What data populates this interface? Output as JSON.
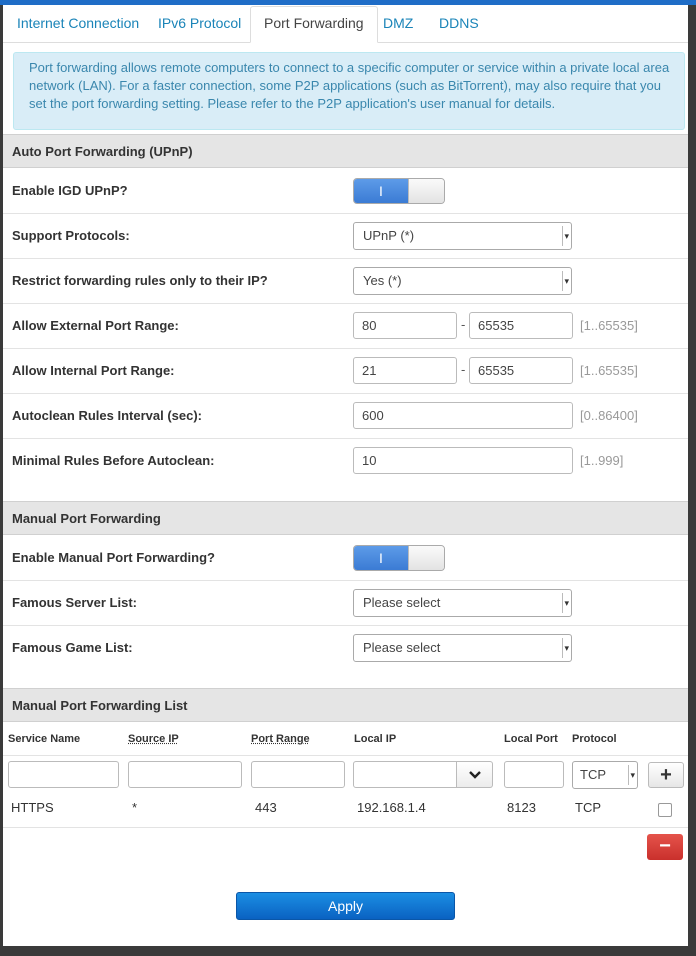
{
  "tabs": [
    {
      "label": "Internet Connection"
    },
    {
      "label": "IPv6 Protocol"
    },
    {
      "label": "Port Forwarding"
    },
    {
      "label": "DMZ"
    },
    {
      "label": "DDNS"
    }
  ],
  "info_text": "Port forwarding allows remote computers to connect to a specific computer or service within a private local area network (LAN). For a faster connection, some P2P applications (such as BitTorrent), may also require that you set the port forwarding setting. Please refer to the P2P application's user manual for details.",
  "upnp": {
    "title": "Auto Port Forwarding (UPnP)",
    "enable_label": "Enable IGD UPnP?",
    "enable_toggle_text": "I",
    "enabled": true,
    "protocols_label": "Support Protocols:",
    "protocols_value": "UPnP (*)",
    "restrict_label": "Restrict forwarding rules only to their IP?",
    "restrict_value": "Yes (*)",
    "ext_range_label": "Allow External Port Range:",
    "ext_from": "80",
    "ext_to": "65535",
    "ext_hint": "[1..65535]",
    "int_range_label": "Allow Internal Port Range:",
    "int_from": "21",
    "int_to": "65535",
    "int_hint": "[1..65535]",
    "autoclean_label": "Autoclean Rules Interval (sec):",
    "autoclean_value": "600",
    "autoclean_hint": "[0..86400]",
    "minimal_label": "Minimal Rules Before Autoclean:",
    "minimal_value": "10",
    "minimal_hint": "[1..999]",
    "range_dash": "-"
  },
  "manual": {
    "title": "Manual Port Forwarding",
    "enable_label": "Enable Manual Port Forwarding?",
    "enable_toggle_text": "I",
    "enabled": true,
    "server_label": "Famous Server List:",
    "server_value": "Please select",
    "game_label": "Famous Game List:",
    "game_value": "Please select"
  },
  "list": {
    "title": "Manual Port Forwarding List",
    "headers": {
      "service": "Service Name",
      "source": "Source IP",
      "port_range": "Port Range",
      "local_ip": "Local IP",
      "local_port": "Local Port",
      "protocol": "Protocol"
    },
    "new_protocol": "TCP",
    "add_label": "+",
    "delete_label": "−",
    "rows": [
      {
        "service": "HTTPS",
        "source": "*",
        "port_range": "443",
        "local_ip": "192.168.1.4",
        "local_port": "8123",
        "protocol": "TCP"
      }
    ]
  },
  "apply_label": "Apply",
  "colors": {
    "accent": "#1f6dc7",
    "tab_link": "#1a84b8",
    "info_bg": "#d9edf7",
    "info_text": "#3a87ad",
    "toggle_on": "#3b7bd4",
    "delete": "#c9302c"
  }
}
